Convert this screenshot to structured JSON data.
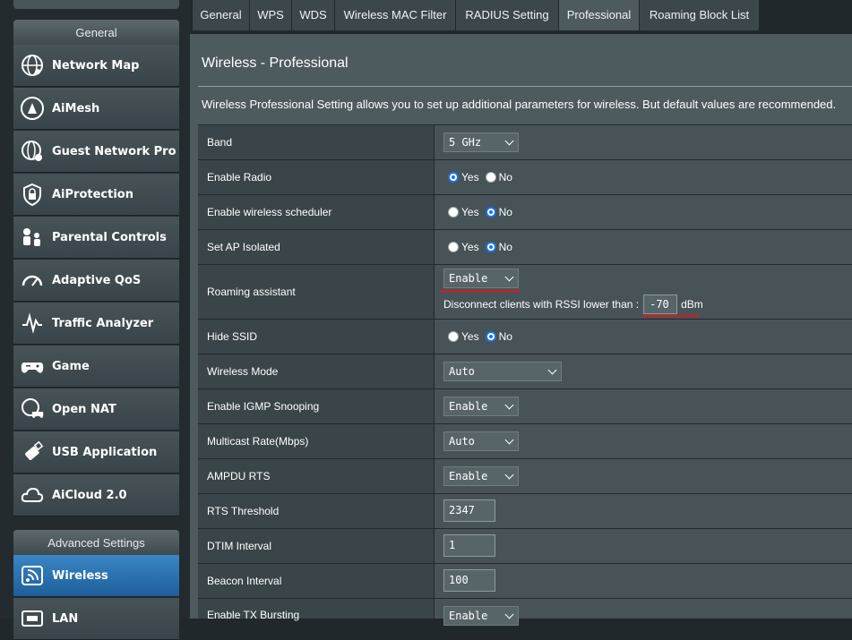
{
  "sidebar": {
    "general_header": "General",
    "advanced_header": "Advanced Settings",
    "items": [
      {
        "label": "Network Map",
        "icon": "globe-network-icon"
      },
      {
        "label": "AiMesh",
        "icon": "aimesh-icon"
      },
      {
        "label": "Guest Network Pro",
        "icon": "guest-globe-icon"
      },
      {
        "label": "AiProtection",
        "icon": "lock-shield-icon"
      },
      {
        "label": "Parental Controls",
        "icon": "family-icon"
      },
      {
        "label": "Adaptive QoS",
        "icon": "speedometer-icon"
      },
      {
        "label": "Traffic Analyzer",
        "icon": "waveform-icon"
      },
      {
        "label": "Game",
        "icon": "gamepad-icon"
      },
      {
        "label": "Open NAT",
        "icon": "globe-gamepad-icon"
      },
      {
        "label": "USB Application",
        "icon": "usb-drive-icon"
      },
      {
        "label": "AiCloud 2.0",
        "icon": "cloud-icon"
      }
    ],
    "advanced_items": [
      {
        "label": "Wireless",
        "icon": "wifi-icon",
        "active": true
      },
      {
        "label": "LAN",
        "icon": "lan-icon"
      }
    ]
  },
  "tabs": [
    "General",
    "WPS",
    "WDS",
    "Wireless MAC Filter",
    "RADIUS Setting",
    "Professional",
    "Roaming Block List"
  ],
  "active_tab": "Professional",
  "page": {
    "title": "Wireless - Professional",
    "description": "Wireless Professional Setting allows you to set up additional parameters for wireless. But default values are recommended."
  },
  "radio_labels": {
    "yes": "Yes",
    "no": "No"
  },
  "settings": {
    "band": {
      "label": "Band",
      "value": "5 GHz"
    },
    "enable_radio": {
      "label": "Enable Radio",
      "selected": "Yes"
    },
    "scheduler": {
      "label": "Enable wireless scheduler",
      "selected": "No"
    },
    "ap_isolated": {
      "label": "Set AP Isolated",
      "selected": "No"
    },
    "roaming": {
      "label": "Roaming assistant",
      "value": "Enable",
      "rssi_text": "Disconnect clients with RSSI lower than :",
      "rssi_value": "-70",
      "rssi_unit": "dBm"
    },
    "hide_ssid": {
      "label": "Hide SSID",
      "selected": "No"
    },
    "wireless_mode": {
      "label": "Wireless Mode",
      "value": "Auto"
    },
    "igmp": {
      "label": "Enable IGMP Snooping",
      "value": "Enable"
    },
    "multicast": {
      "label": "Multicast Rate(Mbps)",
      "value": "Auto"
    },
    "ampdu_rts": {
      "label": "AMPDU RTS",
      "value": "Enable"
    },
    "rts_threshold": {
      "label": "RTS Threshold",
      "value": "2347"
    },
    "dtim": {
      "label": "DTIM Interval",
      "value": "1"
    },
    "beacon": {
      "label": "Beacon Interval",
      "value": "100"
    },
    "tx_bursting": {
      "label": "Enable TX Bursting",
      "value": "Enable"
    }
  },
  "colors": {
    "accent": "#1a73e8",
    "annotation": "#d81b1b",
    "active_menu": "#2a74b5"
  }
}
